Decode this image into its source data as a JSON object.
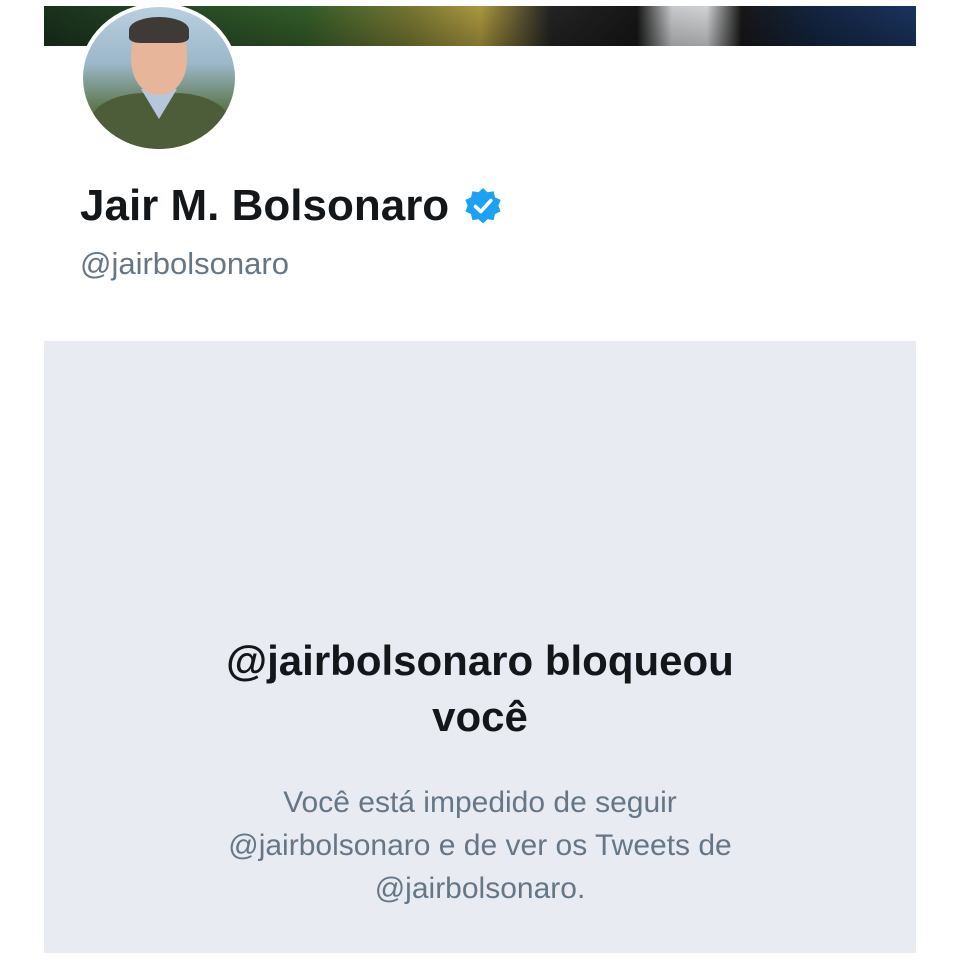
{
  "profile": {
    "display_name": "Jair M. Bolsonaro",
    "handle": "@jairbolsonaro",
    "verified": true,
    "verified_icon": "verified-badge-icon",
    "avatar": "profile-photo"
  },
  "blocked": {
    "title_line1": "@jairbolsonaro bloqueou",
    "title_line2": "você",
    "desc_line1": "Você está impedido de seguir",
    "desc_line2": "@jairbolsonaro e de ver os Tweets de",
    "desc_line3": "@jairbolsonaro."
  },
  "colors": {
    "accent": "#1da1f2",
    "text_primary": "#14171a",
    "text_secondary": "#657786",
    "panel_bg": "#e8ebf2"
  }
}
